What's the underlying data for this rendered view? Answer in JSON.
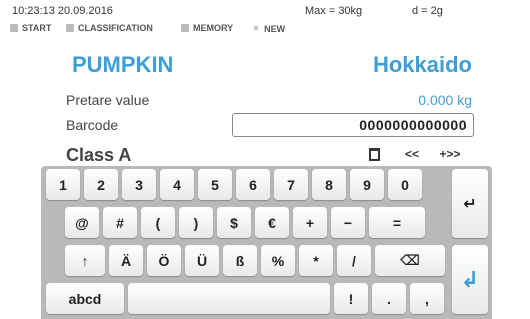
{
  "status": {
    "datetime": "10:23:13 20.09.2016",
    "max": "Max = 30kg",
    "d": "d = 2g"
  },
  "nav": {
    "start": "START",
    "classification": "CLASSIFICATION",
    "memory": "MEMORY",
    "new": "NEW"
  },
  "product": {
    "name": "PUMPKIN",
    "variety": "Hokkaido"
  },
  "pretare": {
    "label": "Pretare value",
    "value": "0.000 kg"
  },
  "barcode": {
    "label": "Barcode",
    "value": "0000000000000"
  },
  "class_label": "Class A",
  "edit_buttons": {
    "delete_icon": "trash-icon",
    "back": "<<",
    "forward": "+>>"
  },
  "keyboard": {
    "row1": [
      "1",
      "2",
      "3",
      "4",
      "5",
      "6",
      "7",
      "8",
      "9",
      "0"
    ],
    "row2": [
      "@",
      "#",
      "(",
      ")",
      "$",
      "€",
      "+",
      "−",
      "="
    ],
    "row3": [
      "↑",
      "Ä",
      "Ö",
      "Ü",
      "ß",
      "%",
      "*",
      "/"
    ],
    "row4": [
      "abcd",
      "",
      "!",
      ".",
      ","
    ],
    "special": {
      "backspace": "⌫",
      "tab": "↵",
      "enter": "↲"
    }
  }
}
